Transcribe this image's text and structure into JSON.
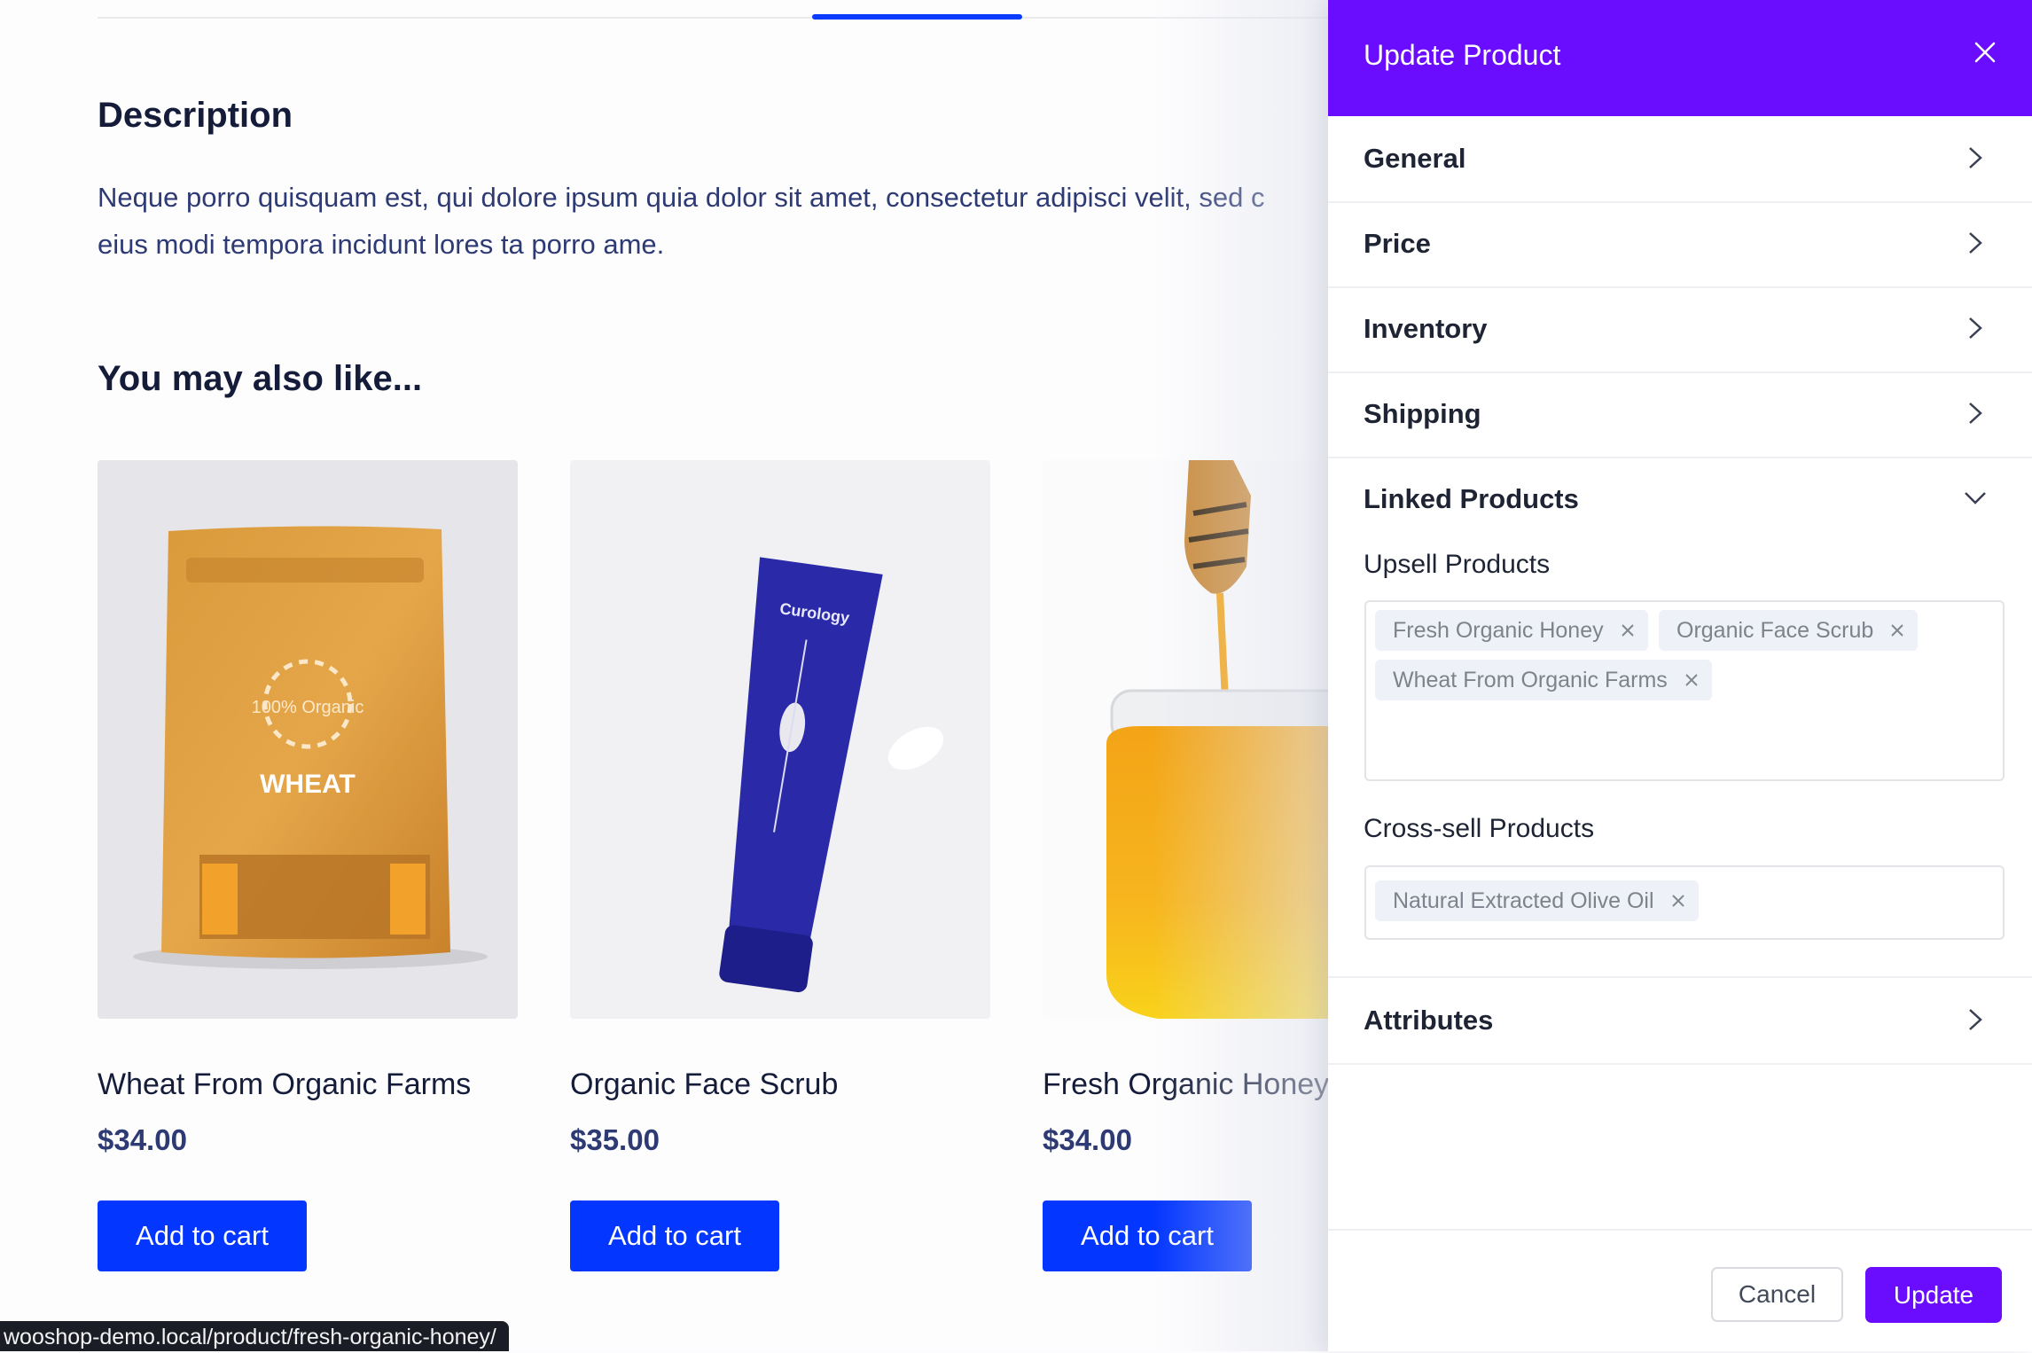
{
  "description": {
    "title": "Description",
    "text_line1": "Neque porro quisquam est, qui dolore ipsum quia dolor sit amet, consectetur adipisci velit, sed c",
    "text_line2": "eius modi tempora incidunt lores ta porro ame."
  },
  "related": {
    "title": "You may also like...",
    "products": [
      {
        "name": "Wheat From Organic Farms",
        "price": "$34.00",
        "button": "Add to cart",
        "image_label": "WHEAT",
        "image_badge": "100% Organic"
      },
      {
        "name": "Organic Face Scrub",
        "price": "$35.00",
        "button": "Add to cart",
        "image_label": "Curology"
      },
      {
        "name": "Fresh Organic Honey",
        "price": "$34.00",
        "button": "Add to cart"
      }
    ]
  },
  "status_bar": {
    "url": "wooshop-demo.local/product/fresh-organic-honey/"
  },
  "panel": {
    "title": "Update Product",
    "sections": [
      {
        "label": "General",
        "expanded": false
      },
      {
        "label": "Price",
        "expanded": false
      },
      {
        "label": "Inventory",
        "expanded": false
      },
      {
        "label": "Shipping",
        "expanded": false
      },
      {
        "label": "Linked Products",
        "expanded": true
      },
      {
        "label": "Attributes",
        "expanded": false
      }
    ],
    "linked": {
      "upsell_label": "Upsell Products",
      "upsell_tags": [
        "Fresh Organic Honey",
        "Organic Face Scrub",
        "Wheat From Organic Farms"
      ],
      "crosssell_label": "Cross-sell Products",
      "crosssell_tags": [
        "Natural Extracted Olive Oil"
      ]
    },
    "cancel_label": "Cancel",
    "update_label": "Update"
  },
  "colors": {
    "accent_purple": "#6a0dff",
    "cart_blue": "#0336ff",
    "tab_blue": "#0a3cff"
  }
}
